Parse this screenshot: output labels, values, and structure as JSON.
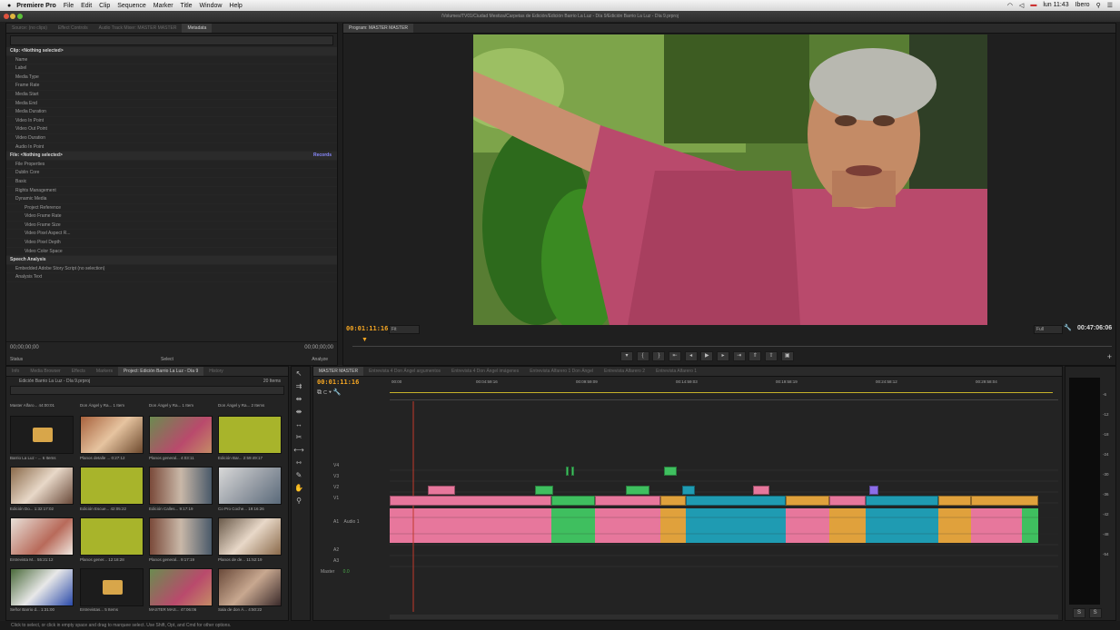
{
  "menubar": {
    "app": "Premiere Pro",
    "items": [
      "File",
      "Edit",
      "Clip",
      "Sequence",
      "Marker",
      "Title",
      "Window",
      "Help"
    ],
    "clock": "lun 11:43",
    "user": "Ibero"
  },
  "window_title": "/Volumes/TV01/Ciudad Mestiza/Carpetas de Edición/Edición Barrio La Luz - Día 9/Edición Barrio La Luz - Día 9.prproj",
  "source_panel": {
    "tabs": [
      "Source: (no clips)",
      "Effect Controls",
      "Audio Track Mixer: MASTER MASTER",
      "Metadata"
    ],
    "active_tab": "Metadata",
    "clip_header": "Clip: <Nothing selected>",
    "clip_fields": [
      "Name",
      "Label",
      "Media Type",
      "Frame Rate",
      "Media Start",
      "Media End",
      "Media Duration",
      "Video In Point",
      "Video Out Point",
      "Video Duration",
      "Audio In Point"
    ],
    "file_header": "File: <Nothing selected>",
    "xmp_label": "Records",
    "file_sections": [
      "File Properties",
      "Dublin Core",
      "Basic",
      "Rights Management",
      "Dynamic Media"
    ],
    "dynamic_items": [
      "Project Reference",
      "Video Frame Rate",
      "Video Frame Size",
      "Video Pixel Aspect R...",
      "Video Pixel Depth",
      "Video Color Space"
    ],
    "speech_header": "Speech Analysis",
    "speech_items": [
      "Embedded Adobe Story Script (no selection)",
      "Analysis Text"
    ],
    "timecode_left": "00;00;00;00",
    "timecode_right": "00;00;00;00",
    "status_left": "Status",
    "status_mid": "Select",
    "status_right": "Analyze"
  },
  "program_panel": {
    "tab": "Program: MASTER MASTER",
    "timecode": "00:01:11:16",
    "fit": "Fit",
    "zoom_label": "Full",
    "duration": "00:47:06:06"
  },
  "project_panel": {
    "tabs": [
      "Info",
      "Media Browser",
      "Effects",
      "Markers",
      "Project: Edición Barrio La Luz - Día 9",
      "History"
    ],
    "active_tab": "Project: Edición Barrio La Luz - Día 9",
    "project_name": "Edición Barrio La Luz - Día 9.prproj",
    "item_count": "20 Items",
    "rows": [
      [
        "Master Alfaro...  44:00:01",
        "Don Ángel y Ra...  1 Item",
        "Don Ángel y Ra...  1 Item",
        "Don Ángel y Ra...  2 Items"
      ],
      [
        "Barrio La Luz - ...  6 Items",
        "Planos detalle ...  0:27:12",
        "Planos general...  4:03:11",
        "Edición Bar...  2:59:49:17"
      ],
      [
        "Edición Do...  1:32:17:02",
        "Edición Escue...  42:05:22",
        "Edición Calles...  9:17:19",
        "Co Pro Coche...  19:16:26"
      ],
      [
        "Entrevista M...  55:21:12",
        "Planos gener...  12:18:28",
        "Planos general...  9:17:19",
        "Planos de de...  11:52:19"
      ],
      [
        "Señor Barrio d...  1:31:00",
        "Entrevistas...  5 Items",
        "MASTER MAS...  47:06:06",
        "Sala de don Á...  4:50:22"
      ]
    ]
  },
  "timeline": {
    "tabs": [
      "MASTER MASTER",
      "Entrevista 4 Don Ángel argumentos",
      "Entrevista 4 Don Ángel imágenes",
      "Entrevista Alfarero 1 Don Ángel",
      "Entrevista Alfarero 2",
      "Entrevista Alfarero 1"
    ],
    "active_tab": "MASTER MASTER",
    "timecode": "00:01:11:16",
    "ruler": [
      "00:00",
      "00:04:59:16",
      "00:09:59:09",
      "00:14:59:03",
      "00:19:58:19",
      "00:24:58:12",
      "00:29:58:04"
    ],
    "tracks": [
      "V4",
      "V3",
      "V2",
      "V1",
      "A1",
      "A2",
      "A3",
      "Master"
    ],
    "audio_label": "Audio 1",
    "master_value": "0.0"
  },
  "meter_labels": [
    "-6",
    "-12",
    "-18",
    "-24",
    "-30",
    "-36",
    "-42",
    "-48",
    "-54"
  ],
  "status_bar": "Click to select, or click in empty space and drag to marquee select. Use Shift, Opt, and Cmd for other options.",
  "colors": {
    "accent": "#f5a623",
    "pink": "#e7779c",
    "green": "#3fbf5f",
    "teal": "#1f9bb2",
    "orange": "#e0a13c",
    "violet": "#8c6de8"
  }
}
